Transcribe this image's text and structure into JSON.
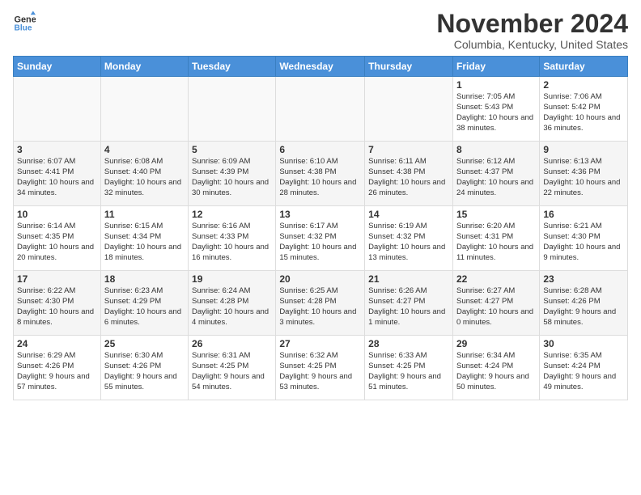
{
  "header": {
    "logo_line1": "General",
    "logo_line2": "Blue",
    "month": "November 2024",
    "location": "Columbia, Kentucky, United States"
  },
  "days_of_week": [
    "Sunday",
    "Monday",
    "Tuesday",
    "Wednesday",
    "Thursday",
    "Friday",
    "Saturday"
  ],
  "weeks": [
    [
      {
        "day": "",
        "info": ""
      },
      {
        "day": "",
        "info": ""
      },
      {
        "day": "",
        "info": ""
      },
      {
        "day": "",
        "info": ""
      },
      {
        "day": "",
        "info": ""
      },
      {
        "day": "1",
        "info": "Sunrise: 7:05 AM\nSunset: 5:43 PM\nDaylight: 10 hours and 38 minutes."
      },
      {
        "day": "2",
        "info": "Sunrise: 7:06 AM\nSunset: 5:42 PM\nDaylight: 10 hours and 36 minutes."
      }
    ],
    [
      {
        "day": "3",
        "info": "Sunrise: 6:07 AM\nSunset: 4:41 PM\nDaylight: 10 hours and 34 minutes."
      },
      {
        "day": "4",
        "info": "Sunrise: 6:08 AM\nSunset: 4:40 PM\nDaylight: 10 hours and 32 minutes."
      },
      {
        "day": "5",
        "info": "Sunrise: 6:09 AM\nSunset: 4:39 PM\nDaylight: 10 hours and 30 minutes."
      },
      {
        "day": "6",
        "info": "Sunrise: 6:10 AM\nSunset: 4:38 PM\nDaylight: 10 hours and 28 minutes."
      },
      {
        "day": "7",
        "info": "Sunrise: 6:11 AM\nSunset: 4:38 PM\nDaylight: 10 hours and 26 minutes."
      },
      {
        "day": "8",
        "info": "Sunrise: 6:12 AM\nSunset: 4:37 PM\nDaylight: 10 hours and 24 minutes."
      },
      {
        "day": "9",
        "info": "Sunrise: 6:13 AM\nSunset: 4:36 PM\nDaylight: 10 hours and 22 minutes."
      }
    ],
    [
      {
        "day": "10",
        "info": "Sunrise: 6:14 AM\nSunset: 4:35 PM\nDaylight: 10 hours and 20 minutes."
      },
      {
        "day": "11",
        "info": "Sunrise: 6:15 AM\nSunset: 4:34 PM\nDaylight: 10 hours and 18 minutes."
      },
      {
        "day": "12",
        "info": "Sunrise: 6:16 AM\nSunset: 4:33 PM\nDaylight: 10 hours and 16 minutes."
      },
      {
        "day": "13",
        "info": "Sunrise: 6:17 AM\nSunset: 4:32 PM\nDaylight: 10 hours and 15 minutes."
      },
      {
        "day": "14",
        "info": "Sunrise: 6:19 AM\nSunset: 4:32 PM\nDaylight: 10 hours and 13 minutes."
      },
      {
        "day": "15",
        "info": "Sunrise: 6:20 AM\nSunset: 4:31 PM\nDaylight: 10 hours and 11 minutes."
      },
      {
        "day": "16",
        "info": "Sunrise: 6:21 AM\nSunset: 4:30 PM\nDaylight: 10 hours and 9 minutes."
      }
    ],
    [
      {
        "day": "17",
        "info": "Sunrise: 6:22 AM\nSunset: 4:30 PM\nDaylight: 10 hours and 8 minutes."
      },
      {
        "day": "18",
        "info": "Sunrise: 6:23 AM\nSunset: 4:29 PM\nDaylight: 10 hours and 6 minutes."
      },
      {
        "day": "19",
        "info": "Sunrise: 6:24 AM\nSunset: 4:28 PM\nDaylight: 10 hours and 4 minutes."
      },
      {
        "day": "20",
        "info": "Sunrise: 6:25 AM\nSunset: 4:28 PM\nDaylight: 10 hours and 3 minutes."
      },
      {
        "day": "21",
        "info": "Sunrise: 6:26 AM\nSunset: 4:27 PM\nDaylight: 10 hours and 1 minute."
      },
      {
        "day": "22",
        "info": "Sunrise: 6:27 AM\nSunset: 4:27 PM\nDaylight: 10 hours and 0 minutes."
      },
      {
        "day": "23",
        "info": "Sunrise: 6:28 AM\nSunset: 4:26 PM\nDaylight: 9 hours and 58 minutes."
      }
    ],
    [
      {
        "day": "24",
        "info": "Sunrise: 6:29 AM\nSunset: 4:26 PM\nDaylight: 9 hours and 57 minutes."
      },
      {
        "day": "25",
        "info": "Sunrise: 6:30 AM\nSunset: 4:26 PM\nDaylight: 9 hours and 55 minutes."
      },
      {
        "day": "26",
        "info": "Sunrise: 6:31 AM\nSunset: 4:25 PM\nDaylight: 9 hours and 54 minutes."
      },
      {
        "day": "27",
        "info": "Sunrise: 6:32 AM\nSunset: 4:25 PM\nDaylight: 9 hours and 53 minutes."
      },
      {
        "day": "28",
        "info": "Sunrise: 6:33 AM\nSunset: 4:25 PM\nDaylight: 9 hours and 51 minutes."
      },
      {
        "day": "29",
        "info": "Sunrise: 6:34 AM\nSunset: 4:24 PM\nDaylight: 9 hours and 50 minutes."
      },
      {
        "day": "30",
        "info": "Sunrise: 6:35 AM\nSunset: 4:24 PM\nDaylight: 9 hours and 49 minutes."
      }
    ]
  ]
}
